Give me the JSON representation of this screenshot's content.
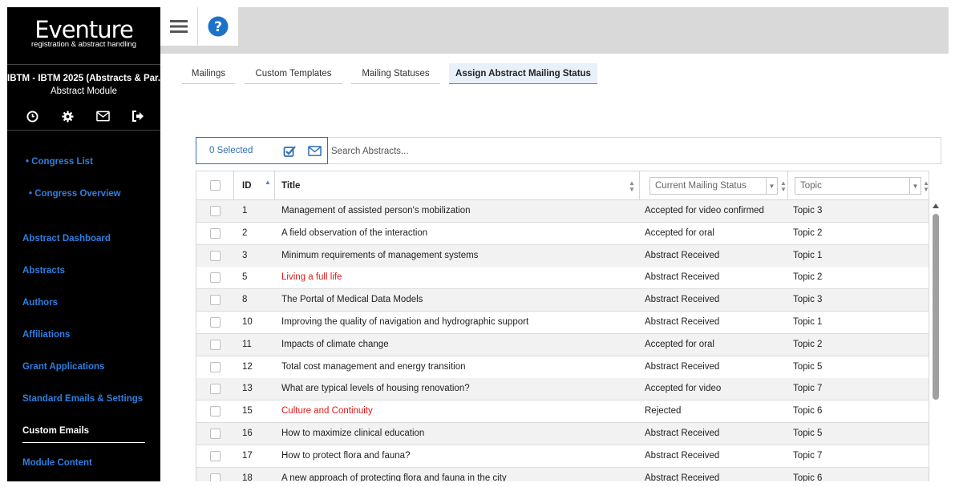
{
  "sidebar": {
    "brand_name": "Eventure",
    "brand_tagline": "registration & abstract handling",
    "module_title": "IBTM - IBTM 2025 (Abstracts & Par...",
    "module_subtitle": "Abstract Module",
    "icons": [
      "clock-icon",
      "gear-icon",
      "mail-icon",
      "logout-icon"
    ],
    "congress_links": [
      "• Congress List",
      "• Congress Overview"
    ],
    "nav": [
      {
        "label": "Abstract Dashboard",
        "active": false
      },
      {
        "label": "Abstracts",
        "active": false
      },
      {
        "label": "Authors",
        "active": false
      },
      {
        "label": "Affiliations",
        "active": false
      },
      {
        "label": "Grant Applications",
        "active": false
      },
      {
        "label": "Standard Emails & Settings",
        "active": false
      },
      {
        "label": "Custom Emails",
        "active": true
      },
      {
        "label": "Module Content",
        "active": false
      }
    ],
    "link_color": "#2f7fe0"
  },
  "topbar": {
    "menu_icon": "hamburger-icon",
    "help_icon": "help-icon",
    "help_color": "#1a73c8"
  },
  "tabs": [
    {
      "label": "Mailings",
      "active": false
    },
    {
      "label": "Custom Templates",
      "active": false
    },
    {
      "label": "Mailing Statuses",
      "active": false
    },
    {
      "label": "Assign Abstract Mailing Status",
      "active": true
    }
  ],
  "toolbar": {
    "selected_label": "0 Selected",
    "search_placeholder": "Search Abstracts...",
    "select_all_icon": "checkbox-check-icon",
    "email_icon": "mail-icon"
  },
  "grid": {
    "columns": {
      "id": "ID",
      "title": "Title",
      "status_filter": "Current Mailing Status",
      "topic_filter": "Topic"
    },
    "rows": [
      {
        "id": "1",
        "title": "Management of assisted person's mobilization",
        "status": "Accepted for video confirmed",
        "topic": "Topic 3",
        "highlight": false
      },
      {
        "id": "2",
        "title": "A field observation of the interaction",
        "status": "Accepted for oral",
        "topic": "Topic 2",
        "highlight": false
      },
      {
        "id": "3",
        "title": "Minimum requirements of management systems",
        "status": "Abstract Received",
        "topic": "Topic 1",
        "highlight": false
      },
      {
        "id": "5",
        "title": "Living a full life",
        "status": "Abstract Received",
        "topic": "Topic 2",
        "highlight": true
      },
      {
        "id": "8",
        "title": "The Portal of Medical Data Models",
        "status": "Abstract Received",
        "topic": "Topic 3",
        "highlight": false
      },
      {
        "id": "10",
        "title": "Improving the quality of navigation and hydrographic support",
        "status": "Abstract Received",
        "topic": "Topic 1",
        "highlight": false
      },
      {
        "id": "11",
        "title": "Impacts of climate change",
        "status": "Accepted for oral",
        "topic": "Topic 2",
        "highlight": false
      },
      {
        "id": "12",
        "title": "Total cost management and energy transition",
        "status": "Abstract Received",
        "topic": "Topic 5",
        "highlight": false
      },
      {
        "id": "13",
        "title": "What are typical levels of housing renovation?",
        "status": "Accepted for video",
        "topic": "Topic 7",
        "highlight": false
      },
      {
        "id": "15",
        "title": "Culture and Continuity",
        "status": "Rejected",
        "topic": "Topic 6",
        "highlight": true
      },
      {
        "id": "16",
        "title": "How to maximize clinical education",
        "status": "Abstract Received",
        "topic": "Topic 5",
        "highlight": false
      },
      {
        "id": "17",
        "title": "How to protect flora and fauna?",
        "status": "Abstract Received",
        "topic": "Topic 7",
        "highlight": false
      },
      {
        "id": "18",
        "title": "A new approach of protecting flora and fauna in the city",
        "status": "Abstract Received",
        "topic": "Topic 6",
        "highlight": false
      }
    ],
    "highlight_color": "#e01919"
  }
}
